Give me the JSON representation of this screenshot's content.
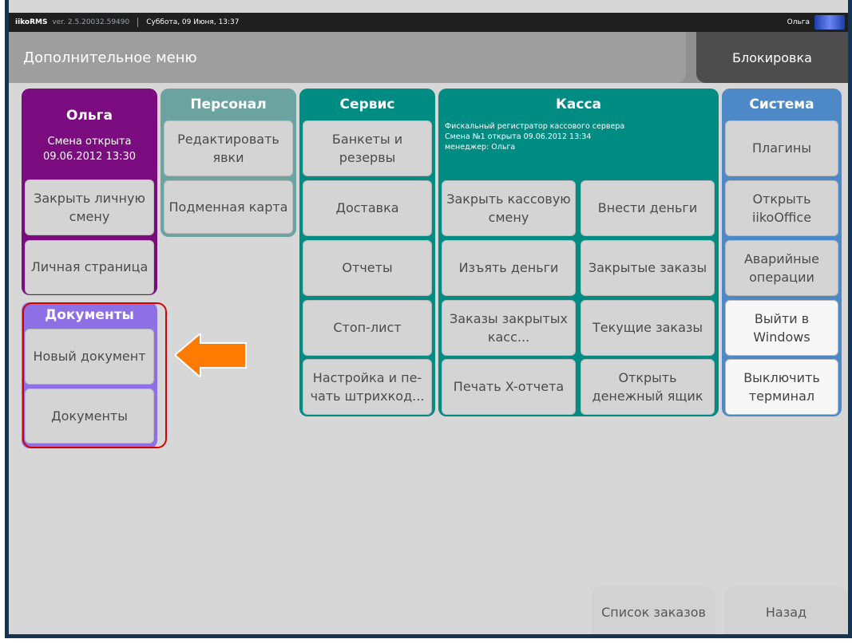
{
  "topbar": {
    "app": "iikoRMS",
    "version": "ver. 2.5.20032.59490",
    "date": "Суббота, 09 Июня, 13:37",
    "user": "Ольга"
  },
  "header": {
    "title": "Дополнительное меню",
    "lock": "Блокировка"
  },
  "olga": {
    "title": "Ольга",
    "shift_line1": "Смена открыта",
    "shift_line2": "09.06.2012 13:30",
    "buttons": [
      "Закрыть личную смену",
      "Личная страница"
    ]
  },
  "personal": {
    "title": "Персонал",
    "buttons": [
      "Редактировать явки",
      "Подменная карта"
    ]
  },
  "service": {
    "title": "Сервис",
    "buttons": [
      "Банкеты и резервы",
      "Доставка",
      "Отчеты",
      "Стоп-лист",
      "Настройка и пе- чать штрихкод..."
    ]
  },
  "cash": {
    "title": "Касса",
    "info_line1": "Фискальный регистратор кассового сервера",
    "info_line2": "Смена №1 открыта 09.06.2012 13:34",
    "info_line3": "менеджер: Ольга",
    "buttons": [
      "Закрыть кассовую смену",
      "Внести деньги",
      "Изъять деньги",
      "Закрытые заказы",
      "Заказы закрытых касс...",
      "Текущие заказы",
      "Печать X-отчета",
      "Открыть денежный ящик"
    ]
  },
  "system": {
    "title": "Система",
    "buttons": [
      "Плагины",
      "Открыть iikoOffice",
      "Аварийные операции",
      "Выйти в Windows",
      "Выключить терминал"
    ]
  },
  "documents": {
    "title": "Документы",
    "buttons": [
      "Новый документ",
      "Документы"
    ]
  },
  "bottom": {
    "orders": "Список заказов",
    "back": "Назад"
  },
  "colors": {
    "olga": "#7a0c7f",
    "personal": "#6aa3a0",
    "service": "#008b83",
    "cash": "#008b83",
    "system": "#4c89c6",
    "documents": "#8d6fe6",
    "highlight": "#d80000",
    "arrow": "#ff7a00"
  }
}
